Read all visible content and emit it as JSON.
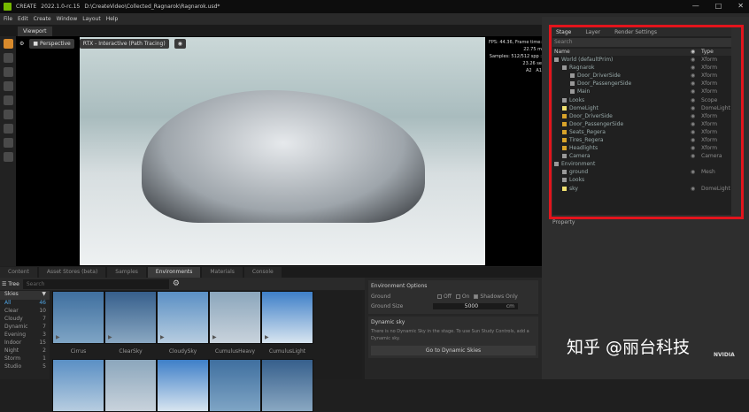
{
  "title": {
    "app": "CREATE",
    "version": "2022.1.0-rc.15",
    "path": "D:\\CreateVideo\\Collected_Ragnarok\\Ragnarok.usd*",
    "controls": [
      "—",
      "□",
      "✕"
    ]
  },
  "menu": [
    "File",
    "Edit",
    "Create",
    "Window",
    "Layout",
    "Help"
  ],
  "viewport": {
    "tab": "Viewport",
    "camera": "Perspective",
    "renderer": "RTX - Interactive (Path Tracing)",
    "stats_line1": "FPS: 44.36, Frame time: 22.75 m",
    "stats_line2": "Samples: 512/512 spp : 23.26 se",
    "labels": [
      "A2",
      "A1"
    ]
  },
  "stage": {
    "tabs": [
      "Stage",
      "Layer",
      "Render Settings"
    ],
    "search_placeholder": "Search",
    "col_name": "Name",
    "col_type": "Type",
    "rows": [
      {
        "name": "World (defaultPrim)",
        "type": "Xform",
        "indent": 0,
        "icon": "xform"
      },
      {
        "name": "Ragnarok",
        "type": "Xform",
        "indent": 1,
        "icon": "xform"
      },
      {
        "name": "Door_DriverSide",
        "type": "Xform",
        "indent": 2,
        "icon": "xform"
      },
      {
        "name": "Door_PassengerSide",
        "type": "Xform",
        "indent": 2,
        "icon": "xform"
      },
      {
        "name": "Main",
        "type": "Xform",
        "indent": 2,
        "icon": "xform"
      },
      {
        "name": "Looks",
        "type": "Scope",
        "indent": 1,
        "icon": "scope"
      },
      {
        "name": "DomeLight",
        "type": "DomeLight",
        "indent": 1,
        "icon": "light"
      },
      {
        "name": "Door_DriverSide",
        "type": "Xform",
        "indent": 1,
        "icon": "xform-y"
      },
      {
        "name": "Door_PassengerSide",
        "type": "Xform",
        "indent": 1,
        "icon": "xform-y"
      },
      {
        "name": "Seats_Regera",
        "type": "Xform",
        "indent": 1,
        "icon": "xform-y"
      },
      {
        "name": "Tires_Regera",
        "type": "Xform",
        "indent": 1,
        "icon": "xform-y"
      },
      {
        "name": "Headlights",
        "type": "Xform",
        "indent": 1,
        "icon": "xform-y"
      },
      {
        "name": "Camera",
        "type": "Camera",
        "indent": 1,
        "icon": "camera"
      },
      {
        "name": "Environment",
        "type": "",
        "indent": 0,
        "icon": "xform"
      },
      {
        "name": "ground",
        "type": "Mesh",
        "indent": 1,
        "icon": "mesh"
      },
      {
        "name": "Looks",
        "type": "",
        "indent": 1,
        "icon": "xform"
      },
      {
        "name": "sky",
        "type": "DomeLight",
        "indent": 1,
        "icon": "light"
      }
    ]
  },
  "property_label": "Property",
  "bottom": {
    "tabs": [
      "Content",
      "Asset Stores (beta)",
      "Samples",
      "Environments",
      "Materials",
      "Console"
    ],
    "active_tab": "Environments",
    "tree_label": "Tree",
    "search_placeholder": "Search",
    "dropdown": "Skies",
    "categories": [
      {
        "name": "All",
        "count": "46"
      },
      {
        "name": "Clear",
        "count": "10"
      },
      {
        "name": "Cloudy",
        "count": "7"
      },
      {
        "name": "Dynamic",
        "count": "7"
      },
      {
        "name": "Evening",
        "count": "3"
      },
      {
        "name": "Indoor",
        "count": "15"
      },
      {
        "name": "Night",
        "count": "2"
      },
      {
        "name": "Storm",
        "count": "1"
      },
      {
        "name": "Studio",
        "count": "5"
      }
    ],
    "thumbs": [
      "Cirrus",
      "ClearSky",
      "CloudySky",
      "CumulusHeavy",
      "CumulusLight"
    ]
  },
  "env_options": {
    "title": "Environment Options",
    "ground_label": "Ground",
    "ground_opts": [
      "Off",
      "On",
      "Shadows Only"
    ],
    "ground_size_label": "Ground Size",
    "ground_size": "5000",
    "unit": "cm",
    "dyn_title": "Dynamic sky",
    "dyn_text": "There is no Dynamic Sky in the stage. To use Sun Study Controls, add a Dynamic sky.",
    "dyn_button": "Go to Dynamic Skies"
  },
  "watermark": "知乎 @丽台科技",
  "brand": "NVIDIA"
}
